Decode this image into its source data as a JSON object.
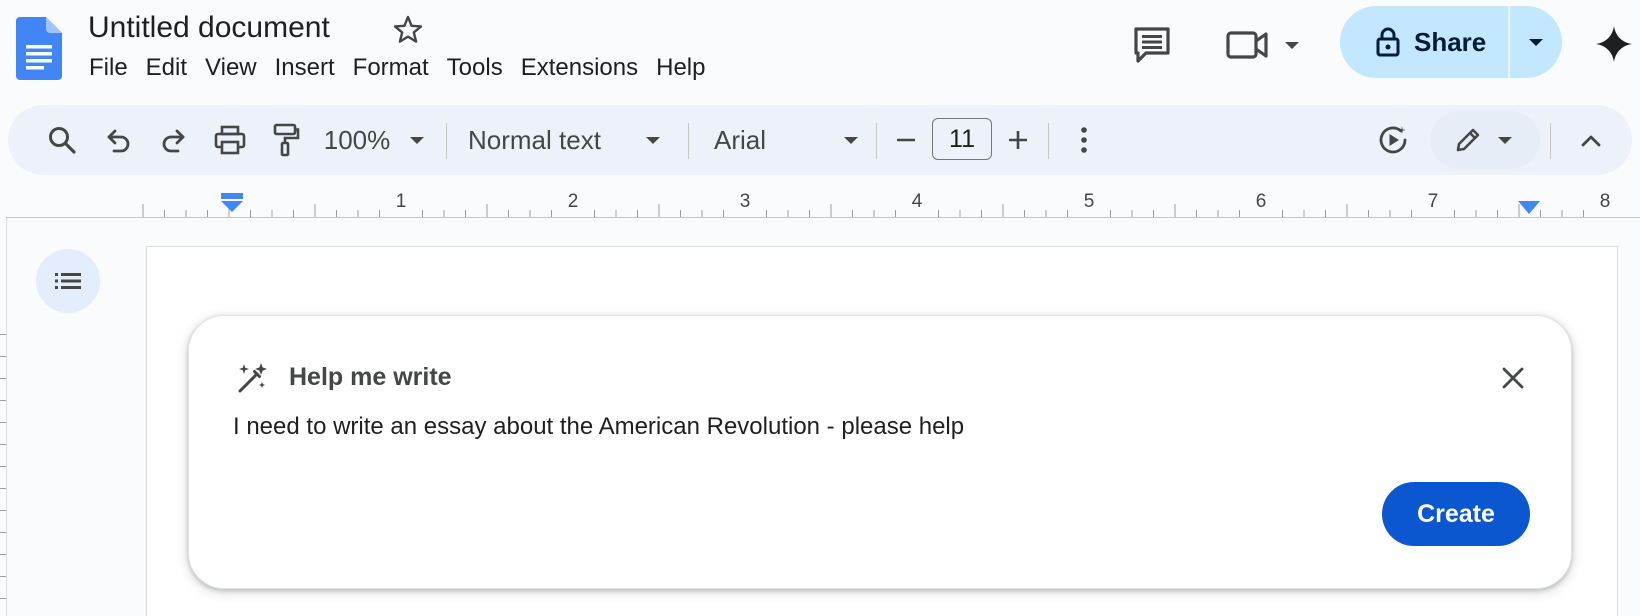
{
  "header": {
    "title": "Untitled document",
    "menu": [
      "File",
      "Edit",
      "View",
      "Insert",
      "Format",
      "Tools",
      "Extensions",
      "Help"
    ],
    "share_label": "Share",
    "icons": [
      "docs-logo-icon",
      "star-icon",
      "comment-icon",
      "video-camera-icon",
      "caret-down-icon",
      "lock-icon",
      "gemini-spark-icon"
    ]
  },
  "toolbar": {
    "zoom": "100%",
    "style": "Normal text",
    "font": "Arial",
    "font_size": "11",
    "icons": [
      "search-icon",
      "undo-icon",
      "redo-icon",
      "print-icon",
      "paint-format-icon",
      "decrease-icon",
      "increase-icon",
      "more-vertical-icon",
      "play-edit-icon",
      "pencil-icon",
      "chevron-up-icon"
    ]
  },
  "ruler": {
    "numbers": [
      "1",
      "2",
      "3",
      "4",
      "5",
      "6",
      "7",
      "8"
    ]
  },
  "help_me_write": {
    "title": "Help me write",
    "prompt": "I need to write an essay about the American Revolution - please help",
    "create_label": "Create"
  },
  "colors": {
    "accent": "#0b57d0",
    "share_bg": "#c2e7ff",
    "toolbar_bg": "#edf2fa",
    "docs_blue": "#4285f4"
  }
}
